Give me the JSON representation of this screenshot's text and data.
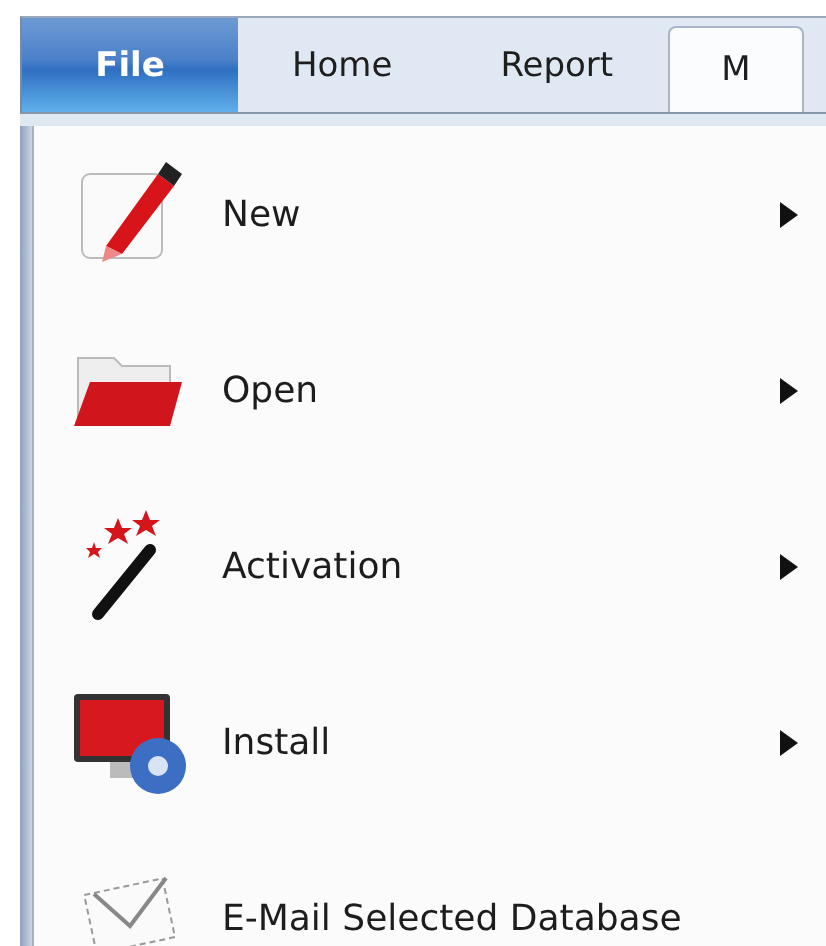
{
  "tabs": [
    {
      "label": "File",
      "kind": "application",
      "selected": false
    },
    {
      "label": "Home",
      "kind": "tab",
      "selected": false
    },
    {
      "label": "Report",
      "kind": "tab",
      "selected": false
    },
    {
      "label": "M",
      "kind": "tab",
      "selected": true
    }
  ],
  "menu": {
    "items": [
      {
        "label": "New",
        "has_submenu": true
      },
      {
        "label": "Open",
        "has_submenu": true
      },
      {
        "label": "Activation",
        "has_submenu": true
      },
      {
        "label": "Install",
        "has_submenu": true
      },
      {
        "label": "E-Mail Selected Database",
        "has_submenu": false
      }
    ]
  }
}
